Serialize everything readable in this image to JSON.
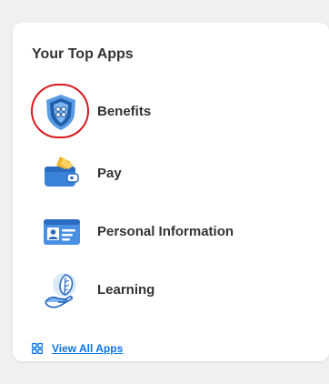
{
  "card": {
    "title": "Your Top Apps"
  },
  "apps": [
    {
      "label": "Benefits",
      "icon": "benefits-shield-icon"
    },
    {
      "label": "Pay",
      "icon": "wallet-icon"
    },
    {
      "label": "Personal Information",
      "icon": "id-card-icon"
    },
    {
      "label": "Learning",
      "icon": "leaf-in-hand-icon"
    }
  ],
  "footer": {
    "view_all_label": "View All Apps",
    "view_all_icon": "grid-icon"
  },
  "colors": {
    "accent": "#0875e1",
    "highlight": "#d7191f",
    "icon_blue": "#4a90e2",
    "icon_dark": "#1c4f8c"
  }
}
